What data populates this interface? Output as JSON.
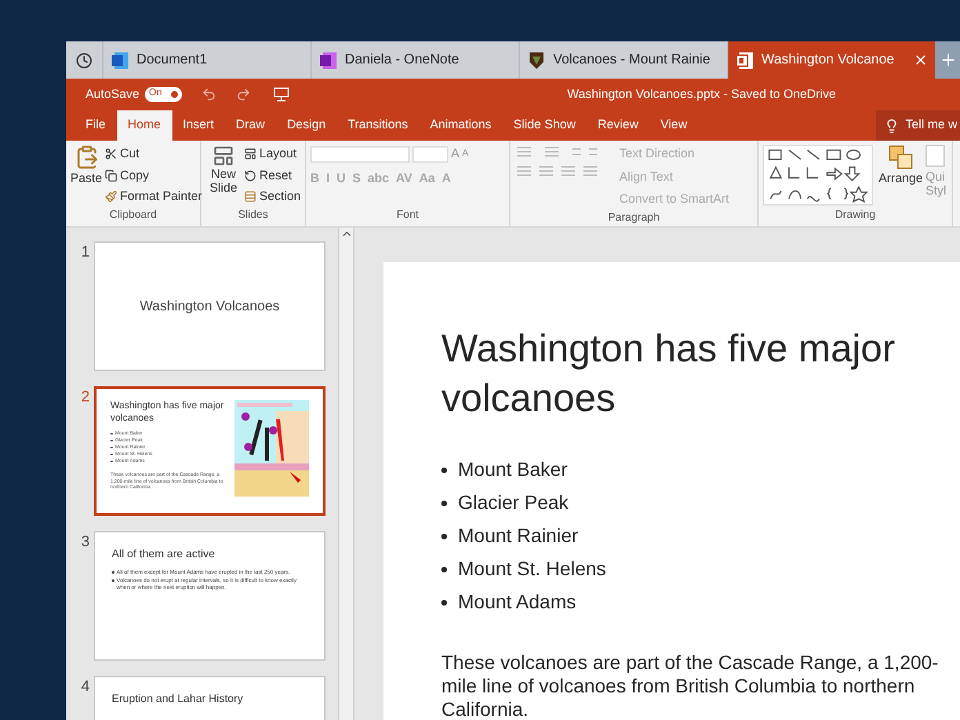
{
  "browser_tabs": [
    {
      "label": "Document1",
      "kind": "word",
      "selected": false
    },
    {
      "label": "Daniela - OneNote",
      "kind": "onenote",
      "selected": false
    },
    {
      "label": "Volcanoes - Mount Rainie",
      "kind": "park",
      "selected": false
    },
    {
      "label": "Washington Volcanoe",
      "kind": "powerpoint",
      "selected": true
    }
  ],
  "title_bar": {
    "autosave_label": "AutoSave",
    "autosave_text": "On",
    "autosave_on": true,
    "file_status": "Washington Volcanoes.pptx - Saved to OneDrive"
  },
  "ribbon_tabs": [
    {
      "label": "File",
      "selected": false
    },
    {
      "label": "Home",
      "selected": true
    },
    {
      "label": "Insert",
      "selected": false
    },
    {
      "label": "Draw",
      "selected": false
    },
    {
      "label": "Design",
      "selected": false
    },
    {
      "label": "Transitions",
      "selected": false
    },
    {
      "label": "Animations",
      "selected": false
    },
    {
      "label": "Slide Show",
      "selected": false
    },
    {
      "label": "Review",
      "selected": false
    },
    {
      "label": "View",
      "selected": false
    }
  ],
  "tell_me": "Tell me w",
  "clipboard": {
    "label": "Clipboard",
    "paste": "Paste",
    "cut": "Cut",
    "copy": "Copy",
    "format_painter": "Format Painter"
  },
  "slides_group": {
    "label": "Slides",
    "new_slide": "New Slide",
    "layout": "Layout",
    "reset": "Reset",
    "section": "Section"
  },
  "font_group": {
    "label": "Font",
    "grow": "A",
    "shrink": "A",
    "buttons": [
      "B",
      "I",
      "U",
      "S",
      "abc",
      "AV",
      "Aa",
      "A"
    ]
  },
  "paragraph_group": {
    "label": "Paragraph",
    "text_direction": "Text Direction",
    "align_text": "Align Text",
    "smartart": "Convert to SmartArt"
  },
  "drawing_group": {
    "label": "Drawing",
    "arrange": "Arrange",
    "quick_styles": "Qui",
    "quick_styles_2": "Styl"
  },
  "slides": [
    {
      "number": "1",
      "kind": "title",
      "selected": false,
      "title": "Washington Volcanoes"
    },
    {
      "number": "2",
      "kind": "picture",
      "selected": true,
      "title": "Washington has five major volcanoes",
      "bullets": [
        "Mount Baker",
        "Glacier Peak",
        "Mount Rainier",
        "Mount St. Helens",
        "Mount Adams"
      ],
      "body": "These volcanoes are part of the Cascade Range, a 1,200-mile line of volcanoes from British Columbia to northern California."
    },
    {
      "number": "3",
      "kind": "content",
      "selected": false,
      "title": "All of them are active",
      "bullets": [
        "All of them except for Mount Adams have erupted in the last 250 years.",
        "Volcanoes do not erupt at regular intervals, so it is difficult to know exactly when or where the next eruption will happen."
      ]
    },
    {
      "number": "4",
      "kind": "content",
      "selected": false,
      "title": "Eruption and Lahar History"
    }
  ],
  "current_slide": {
    "title": "Washington has five major volcanoes",
    "bullets": [
      "Mount Baker",
      "Glacier Peak",
      "Mount Rainier",
      "Mount St. Helens",
      "Mount Adams"
    ],
    "body": "These volcanoes are part of the Cascade Range, a 1,200-mile line of volcanoes from British Columbia to northern California."
  }
}
